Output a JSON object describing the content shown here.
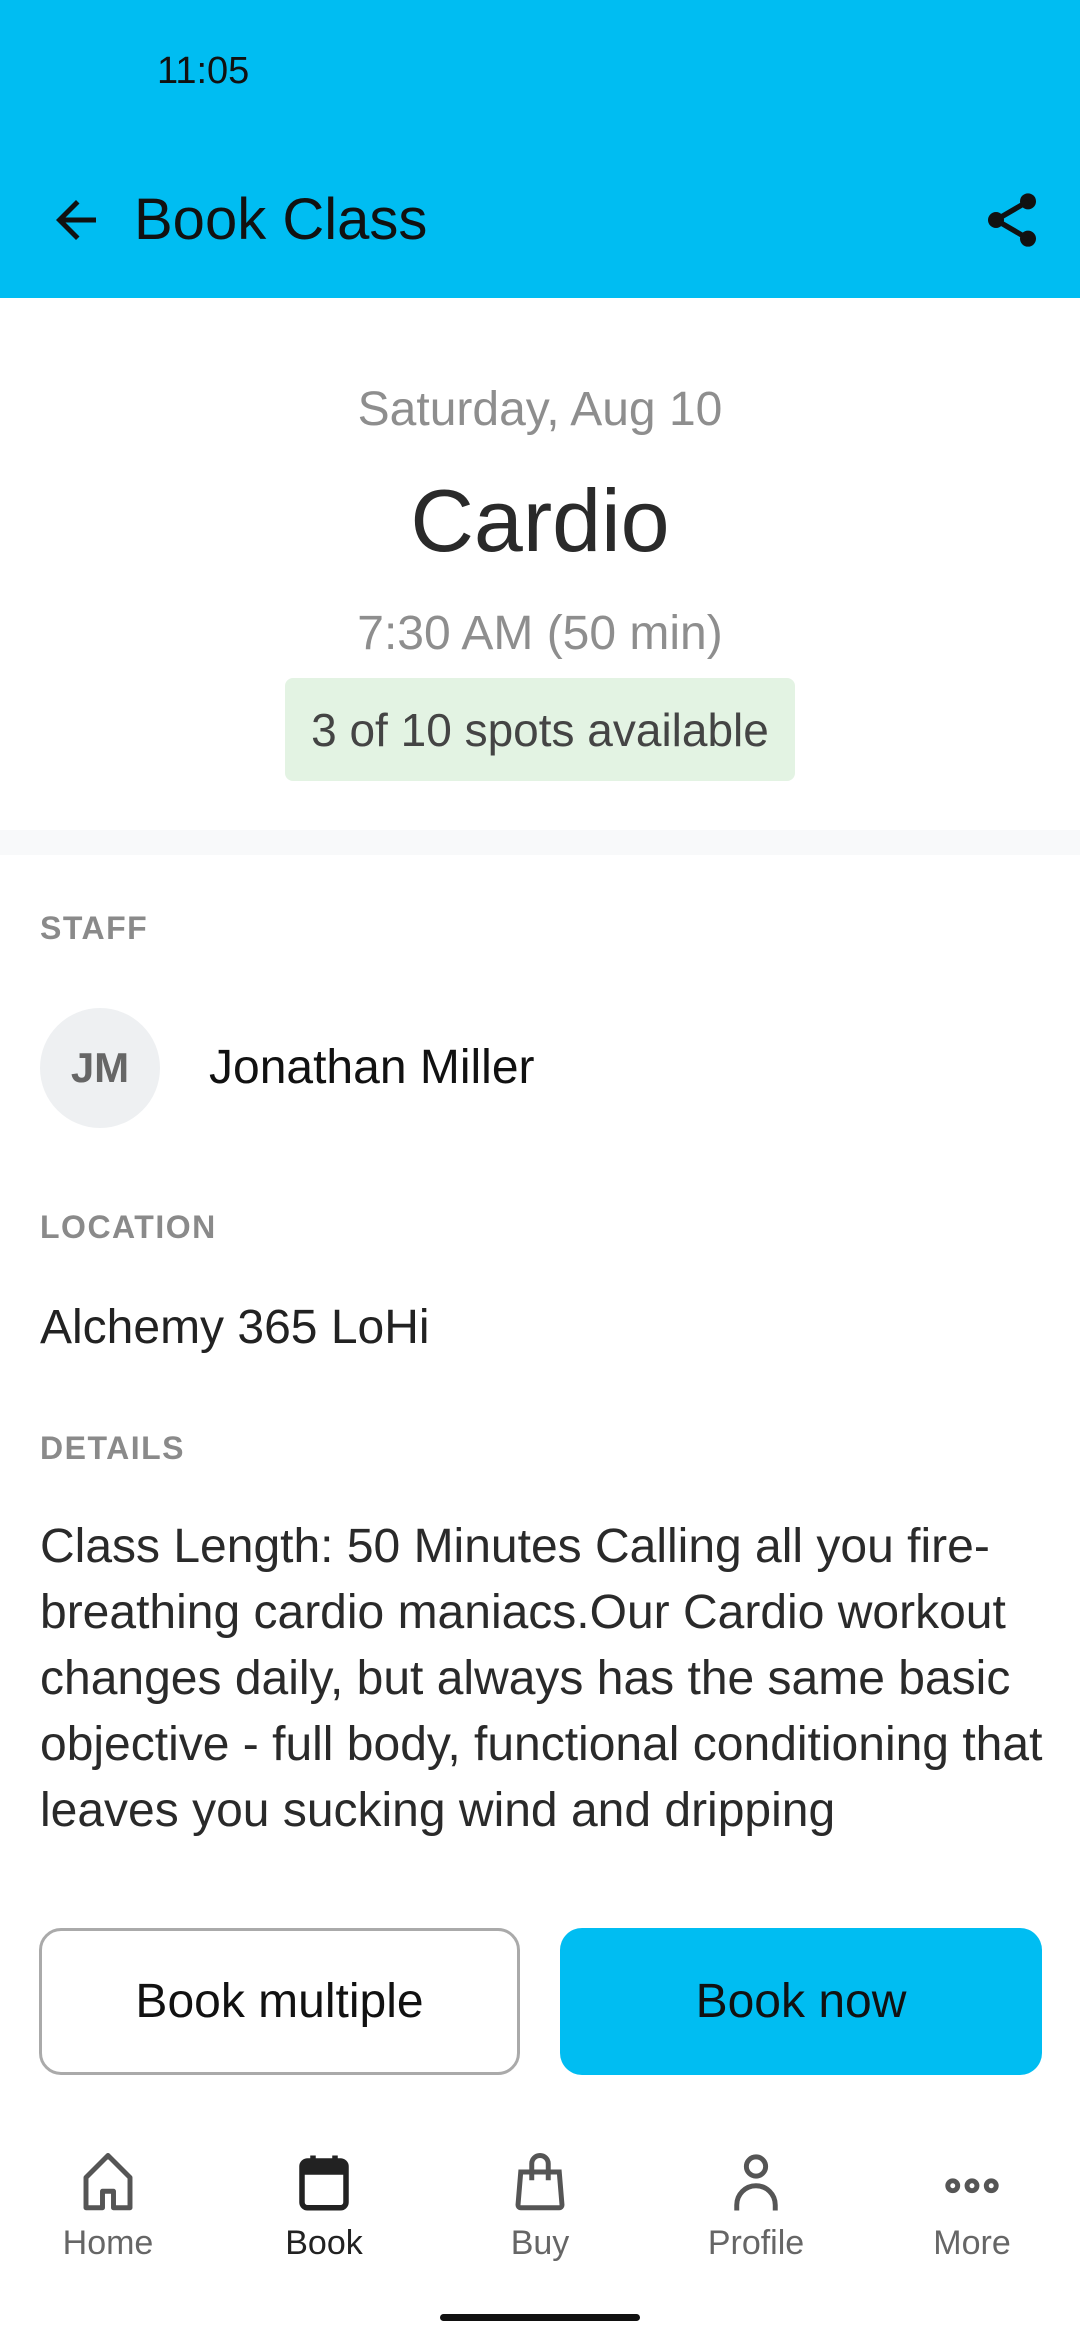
{
  "status_bar": {
    "time": "11:05"
  },
  "header": {
    "title": "Book Class",
    "back_icon": "arrow-left-icon",
    "share_icon": "share-icon",
    "color": "#00bdf2"
  },
  "class": {
    "date": "Saturday, Aug 10",
    "name": "Cardio",
    "time": "7:30 AM (50 min)",
    "availability": "3 of 10 spots available"
  },
  "staff": {
    "label": "STAFF",
    "initials": "JM",
    "name": "Jonathan Miller"
  },
  "location": {
    "label": "LOCATION",
    "value": "Alchemy 365 LoHi"
  },
  "details": {
    "label": "DETAILS",
    "text": "Class Length: 50 Minutes Calling all you fire-breathing cardio maniacs.Our Cardio workout changes daily, but always has the same basic objective - full body, functional conditioning that leaves you sucking wind and dripping"
  },
  "actions": {
    "book_multiple": "Book multiple",
    "book_now": "Book now"
  },
  "nav": {
    "items": [
      {
        "label": "Home",
        "icon": "home-icon"
      },
      {
        "label": "Book",
        "icon": "calendar-icon",
        "active": true
      },
      {
        "label": "Buy",
        "icon": "shopping-bag-icon"
      },
      {
        "label": "Profile",
        "icon": "person-icon"
      },
      {
        "label": "More",
        "icon": "more-icon"
      }
    ]
  }
}
